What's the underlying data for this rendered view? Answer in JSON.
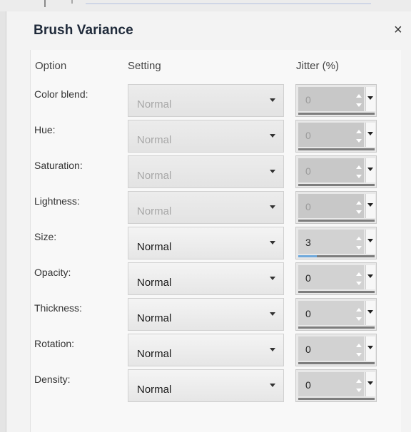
{
  "dialog": {
    "title": "Brush Variance",
    "close_glyph": "×"
  },
  "headers": {
    "option": "Option",
    "setting": "Setting",
    "jitter": "Jitter (%)"
  },
  "rows": [
    {
      "label": "Color blend:",
      "setting": "Normal",
      "enabled": false,
      "jitter": "0",
      "jitter_fraction": 0.0
    },
    {
      "label": "Hue:",
      "setting": "Normal",
      "enabled": false,
      "jitter": "0",
      "jitter_fraction": 0.0
    },
    {
      "label": "Saturation:",
      "setting": "Normal",
      "enabled": false,
      "jitter": "0",
      "jitter_fraction": 0.0
    },
    {
      "label": "Lightness:",
      "setting": "Normal",
      "enabled": false,
      "jitter": "0",
      "jitter_fraction": 0.0
    },
    {
      "label": "Size:",
      "setting": "Normal",
      "enabled": true,
      "jitter": "3",
      "jitter_fraction": 0.03
    },
    {
      "label": "Opacity:",
      "setting": "Normal",
      "enabled": true,
      "jitter": "0",
      "jitter_fraction": 0.0
    },
    {
      "label": "Thickness:",
      "setting": "Normal",
      "enabled": true,
      "jitter": "0",
      "jitter_fraction": 0.0
    },
    {
      "label": "Rotation:",
      "setting": "Normal",
      "enabled": true,
      "jitter": "0",
      "jitter_fraction": 0.0
    },
    {
      "label": "Density:",
      "setting": "Normal",
      "enabled": true,
      "jitter": "0",
      "jitter_fraction": 0.0
    }
  ],
  "colors": {
    "title_text": "#1f2a3a",
    "disabled_text": "#a8a8a8",
    "jitter_fill": "#6fa9dc"
  },
  "icons": {
    "close": "close-icon",
    "dropdown": "chevron-down-icon",
    "spinner": "up-down-arrows-icon"
  }
}
